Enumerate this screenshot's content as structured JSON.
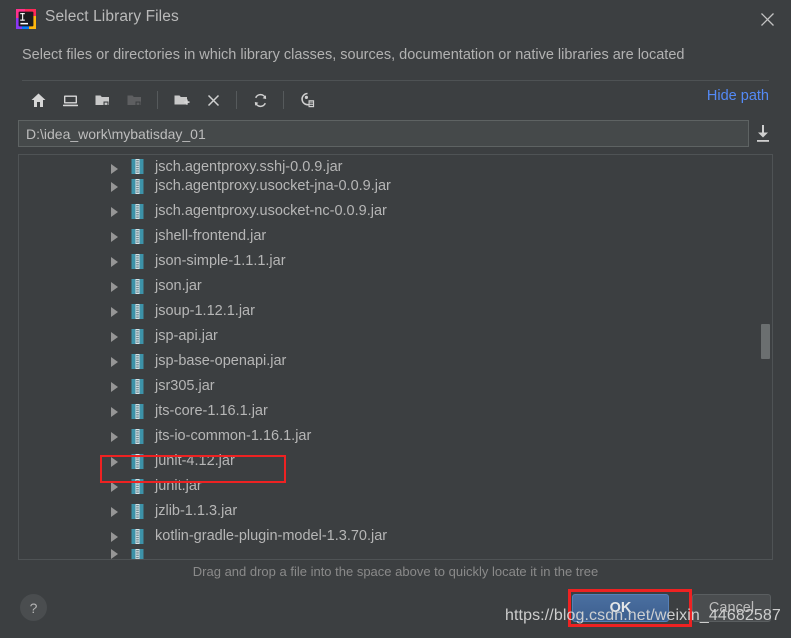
{
  "window": {
    "title": "Select Library Files",
    "logo_icon": "intellij-idea-logo",
    "close_icon": "close-icon",
    "subtitle": "Select files or directories in which library classes, sources, documentation or native libraries are located"
  },
  "toolbar": {
    "buttons": [
      {
        "name": "home-icon",
        "tooltip": "Home",
        "enabled": true
      },
      {
        "name": "desktop-icon",
        "tooltip": "Desktop",
        "enabled": true
      },
      {
        "name": "folder-project-icon",
        "tooltip": "Project Directory",
        "enabled": true
      },
      {
        "name": "folder-module-icon",
        "tooltip": "Module Directory",
        "enabled": false
      },
      {
        "name": "new-folder-icon",
        "tooltip": "New Folder",
        "enabled": true
      },
      {
        "name": "delete-icon",
        "tooltip": "Delete",
        "enabled": true
      },
      {
        "name": "refresh-icon",
        "tooltip": "Refresh",
        "enabled": true
      },
      {
        "name": "show-hidden-files-icon",
        "tooltip": "Show Hidden Files",
        "enabled": true
      }
    ],
    "hide_path_label": "Hide path"
  },
  "path_bar": {
    "value": "D:\\idea_work\\mybatisday_01",
    "placeholder": "",
    "import_icon": "import-download-icon"
  },
  "file_list": {
    "items": [
      {
        "name": "jsch.agentproxy.sshj-0.0.9.jar",
        "icon": "jar-file-icon",
        "expandable": true,
        "partial_top": true
      },
      {
        "name": "jsch.agentproxy.usocket-jna-0.0.9.jar",
        "icon": "jar-file-icon",
        "expandable": true
      },
      {
        "name": "jsch.agentproxy.usocket-nc-0.0.9.jar",
        "icon": "jar-file-icon",
        "expandable": true
      },
      {
        "name": "jshell-frontend.jar",
        "icon": "jar-file-icon",
        "expandable": true
      },
      {
        "name": "json-simple-1.1.1.jar",
        "icon": "jar-file-icon",
        "expandable": true
      },
      {
        "name": "json.jar",
        "icon": "jar-file-icon",
        "expandable": true
      },
      {
        "name": "jsoup-1.12.1.jar",
        "icon": "jar-file-icon",
        "expandable": true
      },
      {
        "name": "jsp-api.jar",
        "icon": "jar-file-icon",
        "expandable": true
      },
      {
        "name": "jsp-base-openapi.jar",
        "icon": "jar-file-icon",
        "expandable": true
      },
      {
        "name": "jsr305.jar",
        "icon": "jar-file-icon",
        "expandable": true
      },
      {
        "name": "jts-core-1.16.1.jar",
        "icon": "jar-file-icon",
        "expandable": true
      },
      {
        "name": "jts-io-common-1.16.1.jar",
        "icon": "jar-file-icon",
        "expandable": true
      },
      {
        "name": "junit-4.12.jar",
        "icon": "jar-file-icon",
        "expandable": true,
        "highlighted": true
      },
      {
        "name": "junit.jar",
        "icon": "jar-file-icon",
        "expandable": true
      },
      {
        "name": "jzlib-1.1.3.jar",
        "icon": "jar-file-icon",
        "expandable": true
      },
      {
        "name": "kotlin-gradle-plugin-model-1.3.70.jar",
        "icon": "jar-file-icon",
        "expandable": true
      }
    ],
    "scrollbar": {
      "name": "vertical-scrollbar"
    }
  },
  "hint": "Drag and drop a file into the space above to quickly locate it in the tree",
  "footer": {
    "help_label": "?",
    "ok_label": "OK",
    "cancel_label": "Cancel"
  },
  "annotations": {
    "highlight_color": "#ee2222",
    "watermark": "https://blog.csdn.net/weixin_44682587"
  },
  "colors": {
    "dialog_bg": "#3c3f41",
    "field_bg": "#45494a",
    "accent_link": "#548af7",
    "ok_button": "#3d5f8f",
    "text": "#b6b6b6"
  }
}
